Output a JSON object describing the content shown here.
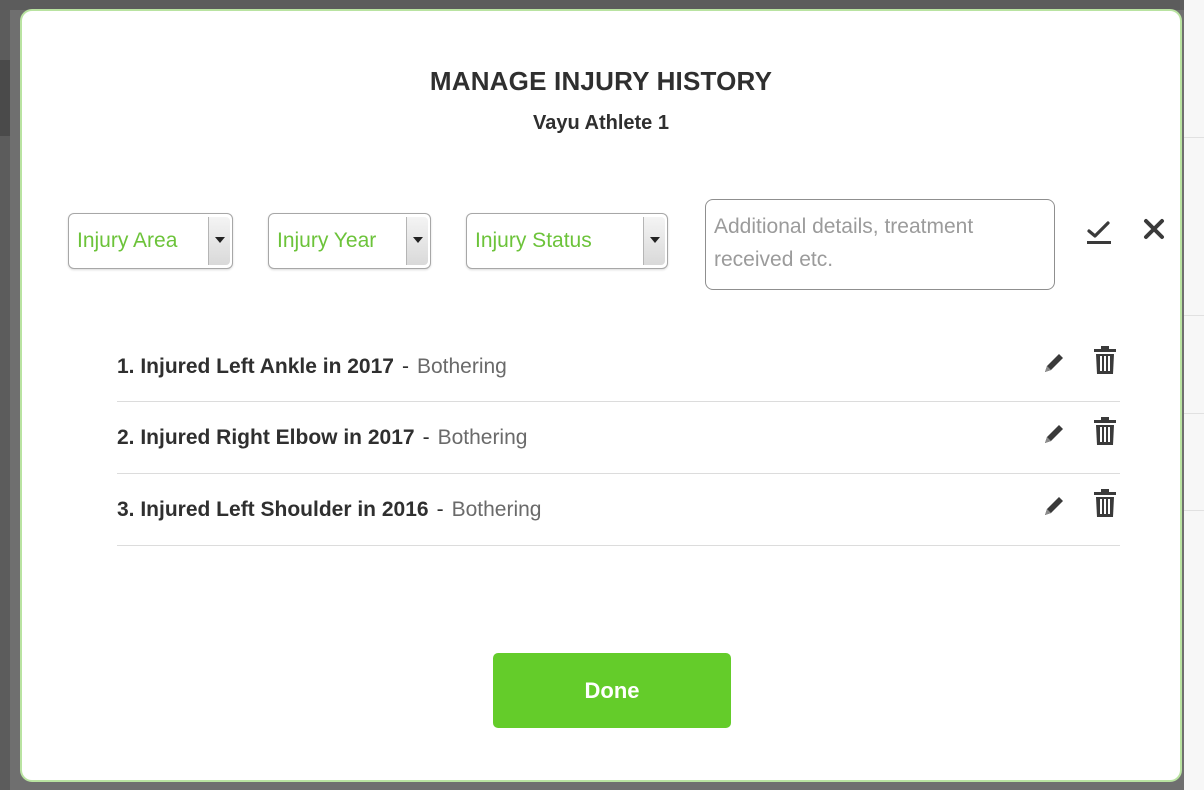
{
  "modal": {
    "title": "MANAGE INJURY HISTORY",
    "subtitle": "Vayu Athlete 1"
  },
  "form": {
    "injury_area": "Injury Area",
    "injury_year": "Injury Year",
    "injury_status": "Injury Status",
    "details_placeholder": "Additional details, treatment received etc.",
    "save_icon": "checkmark-underline-icon",
    "cancel_icon": "x-icon"
  },
  "injuries": [
    {
      "text": "1. Injured Left Ankle in 2017",
      "separator": "-",
      "status": "Bothering"
    },
    {
      "text": "2. Injured Right Elbow in 2017",
      "separator": "-",
      "status": "Bothering"
    },
    {
      "text": "3. Injured Left Shoulder in 2016",
      "separator": "-",
      "status": "Bothering"
    }
  ],
  "actions": {
    "done_label": "Done"
  },
  "colors": {
    "accent_green": "#64cc2a",
    "select_text_green": "#6cc33a",
    "modal_border": "#b9e3a1"
  }
}
